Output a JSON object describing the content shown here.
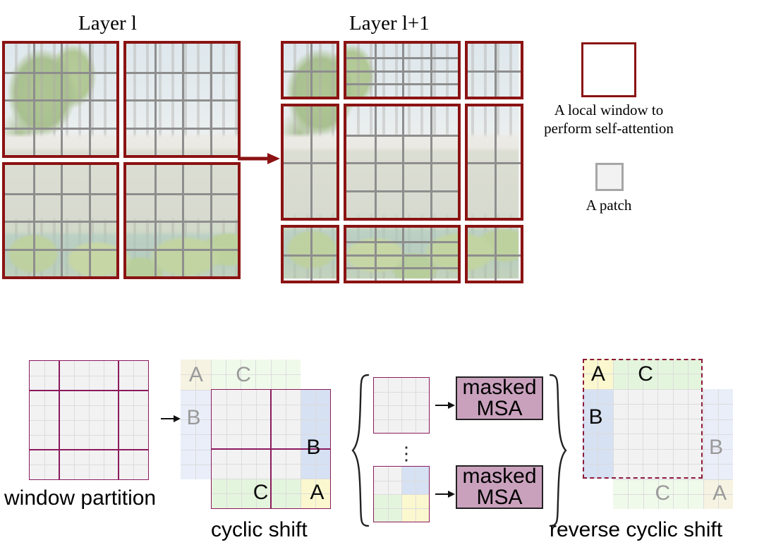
{
  "figure": {
    "top": {
      "layer_l_title": "Layer l",
      "layer_l1_title": "Layer l+1",
      "arrow": "right-arrow",
      "legend": {
        "window_text_line1": "A local window to",
        "window_text_line2": "perform self-attention",
        "patch_text": "A patch",
        "window_border_color": "#8b1313",
        "patch_border_color": "#a6a6a6"
      },
      "grid": {
        "layer_l_windows": 4,
        "layer_l1_windows": 9,
        "patches_per_window": "4x4"
      }
    },
    "bottom": {
      "captions": {
        "window_partition": "window partition",
        "cyclic_shift": "cyclic shift",
        "reverse_cyclic_shift": "reverse cyclic shift"
      },
      "region_labels": {
        "a": "A",
        "b": "B",
        "c": "C"
      },
      "msa_blocks": [
        {
          "line1": "masked",
          "line2": "MSA"
        },
        {
          "line1": "masked",
          "line2": "MSA"
        }
      ],
      "ellipsis": "⋮",
      "arrows": {
        "partition_to_shift": "→",
        "grid_to_msa": "→"
      },
      "colors": {
        "region_a": "#fbf8cf",
        "region_b": "#d6e1f3",
        "region_c": "#e4f5dd",
        "neutral": "#f2f2f2",
        "window_border": "#8b1a5e",
        "msa_fill": "#c9a1bd",
        "dashed_border": "#8b1a3a",
        "faded_a": "#f6f3e2",
        "faded_b": "#e9eef9",
        "faded_c": "#f0faeb"
      }
    }
  }
}
